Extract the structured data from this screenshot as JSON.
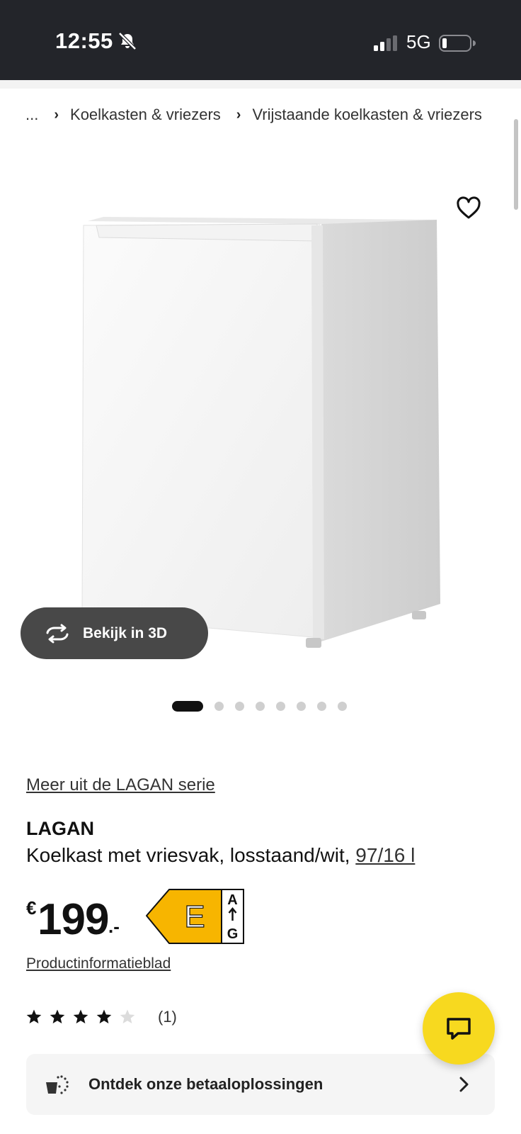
{
  "status_bar": {
    "time": "12:55",
    "network": "5G",
    "icons": [
      "bell-off-icon",
      "signal-icon",
      "battery-icon"
    ]
  },
  "breadcrumb": {
    "ellipsis": "...",
    "items": [
      "Koelkasten & vriezers",
      "Vrijstaande koelkasten & vriezers"
    ]
  },
  "gallery": {
    "view_3d_label": "Bekijk in 3D",
    "total_images": 8,
    "active_index": 0
  },
  "product": {
    "series_link": "Meer uit de LAGAN serie",
    "name": "LAGAN",
    "description": "Koelkast met vriesvak, losstaand/wit, ",
    "volume": "97/16 l",
    "price": {
      "currency": "€",
      "integer": "199",
      "decimals": ".-"
    },
    "energy_label": {
      "class": "E",
      "scale_top": "A",
      "scale_bottom": "G",
      "color": "#f7b500"
    },
    "info_sheet_link": "Productinformatieblad",
    "rating": {
      "stars": 4,
      "max": 5,
      "count": "(1)"
    }
  },
  "payment_card": {
    "label": "Ontdek onze betaaloplossingen"
  },
  "colors": {
    "status_bar_bg": "#23252a",
    "chat_button": "#f7d91f",
    "view3d_bg": "#484848"
  }
}
